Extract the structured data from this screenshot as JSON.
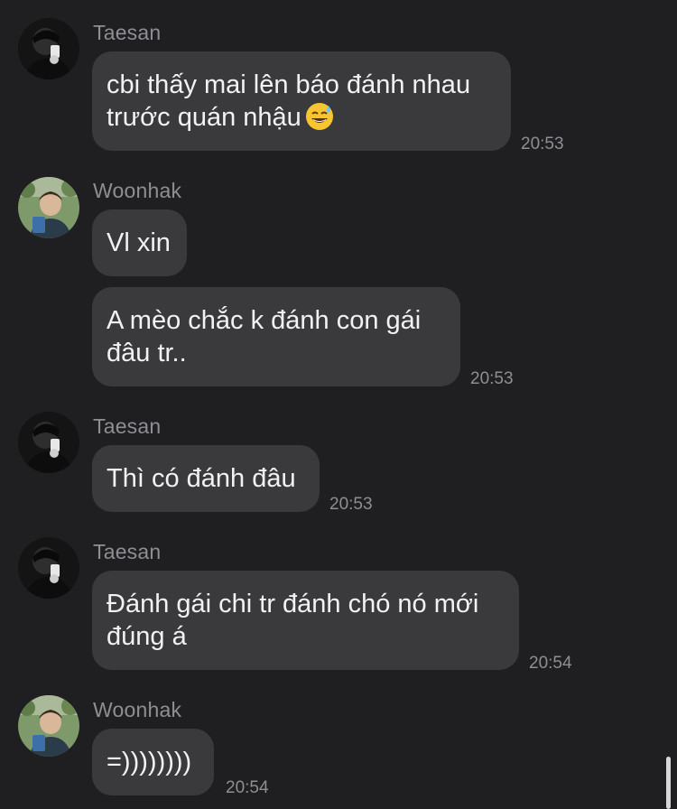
{
  "messages": [
    {
      "sender": "Taesan",
      "lines": [
        "cbi thấy mai lên báo đánh nhau",
        "trước quán nhậu"
      ],
      "emoji": "sweat-smile-emoji",
      "time": "20:53"
    },
    {
      "sender": "Woonhak",
      "lines": [
        "Vl xin"
      ]
    },
    {
      "lines": [
        "A mèo chắc k đánh con gái",
        "đâu tr.."
      ],
      "time": "20:53"
    },
    {
      "sender": "Taesan",
      "lines": [
        "Thì có đánh đâu"
      ],
      "time": "20:53"
    },
    {
      "sender": "Taesan",
      "lines": [
        "Đánh gái chi tr đánh chó nó mới",
        "đúng á"
      ],
      "time": "20:54"
    },
    {
      "sender": "Woonhak",
      "lines": [
        "=))))))))"
      ],
      "time": "20:54"
    }
  ],
  "colors": {
    "background": "#1f1f21",
    "bubble": "#3a3a3c",
    "text": "#f2f2f4",
    "meta": "#8e8e93"
  }
}
